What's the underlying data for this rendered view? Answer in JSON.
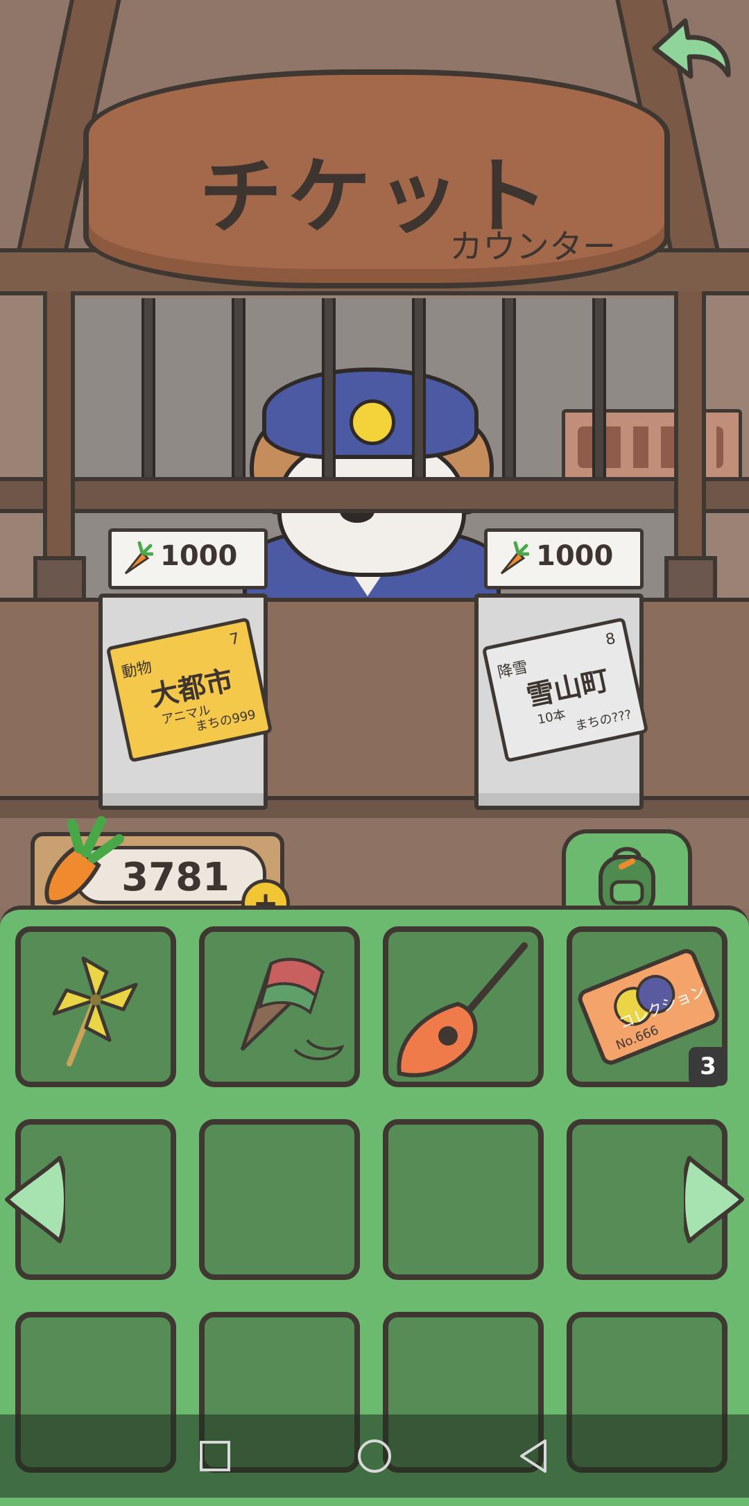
{
  "sign": {
    "title": "チケット",
    "subtitle": "カウンター"
  },
  "tickets": [
    {
      "price": "1000",
      "kicker": "動物",
      "number": "7",
      "name": "大都市",
      "sub": "アニマル",
      "tag": "まちの999",
      "style": "gold"
    },
    {
      "price": "1000",
      "kicker": "降雪",
      "number": "8",
      "name": "雪山町",
      "sub": "10本",
      "tag": "まちの???",
      "style": "silver"
    }
  ],
  "wallet": {
    "carrots": "3781"
  },
  "inventory": {
    "items": [
      {
        "name": "pinwheel",
        "count": null
      },
      {
        "name": "spinning-top",
        "count": null
      },
      {
        "name": "guitar",
        "count": null
      },
      {
        "name": "collection-ticket",
        "count": "3",
        "label": "コレクション",
        "sub": "No.666"
      }
    ]
  },
  "icons": {
    "back": "back-arrow-icon",
    "backpack": "backpack-icon",
    "carrot": "carrot-icon",
    "add": "plus-icon",
    "left": "left-arrow-icon",
    "right": "right-arrow-icon"
  },
  "colors": {
    "panel": "#6cba6f",
    "slot": "#568c55",
    "sign": "#a4694a",
    "outline": "#3f3832",
    "accent_yellow": "#f2c632"
  }
}
